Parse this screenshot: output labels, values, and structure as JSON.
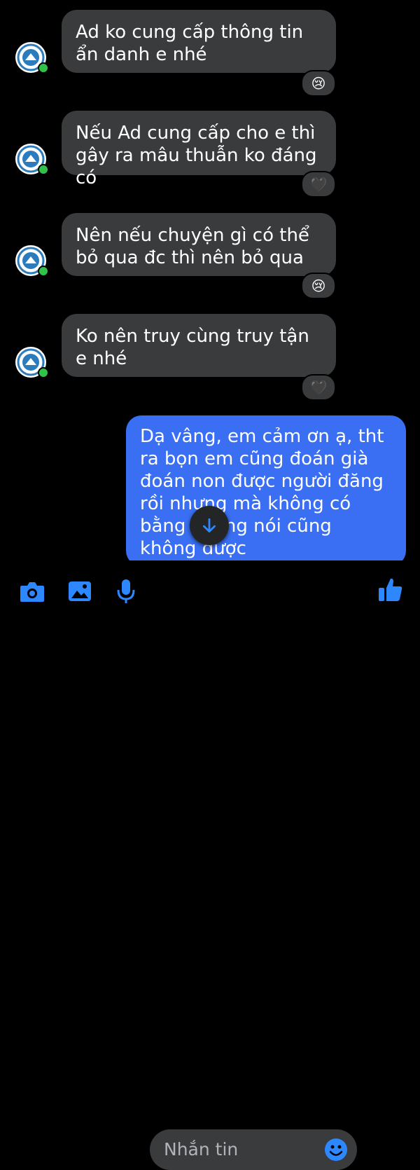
{
  "messages": [
    {
      "sender": "admin",
      "text": "Ad ko cung cấp thông tin ẩn danh e nhé",
      "reaction": "😢"
    },
    {
      "sender": "admin",
      "text": "Nếu Ad cung cấp cho e thì gây ra mâu thuẫn ko đáng có",
      "reaction": "🖤"
    },
    {
      "sender": "admin",
      "text": "Nên nếu chuyện gì có thể bỏ qua đc thì nên bỏ qua",
      "reaction": "😢"
    },
    {
      "sender": "admin",
      "text": "Ko nên truy cùng truy tận e nhé",
      "reaction": "🖤"
    },
    {
      "sender": "me",
      "text": "Dạ vâng, em cảm ơn ạ, tht ra bọn em cũng đoán già đoán non được người đăng rồi nhưng mà không có bằng chứng nói cũng không được"
    }
  ],
  "composer": {
    "placeholder": "Nhắn tin",
    "icons": [
      "camera-icon",
      "gallery-icon",
      "microphone-icon",
      "emoji-icon",
      "thumbs-up-icon"
    ]
  },
  "colors": {
    "background": "#000000",
    "incoming_bubble": "#3a3b3c",
    "outgoing_bubble": "#3a6ff3",
    "accent": "#2d88ff",
    "online": "#31c24a"
  }
}
